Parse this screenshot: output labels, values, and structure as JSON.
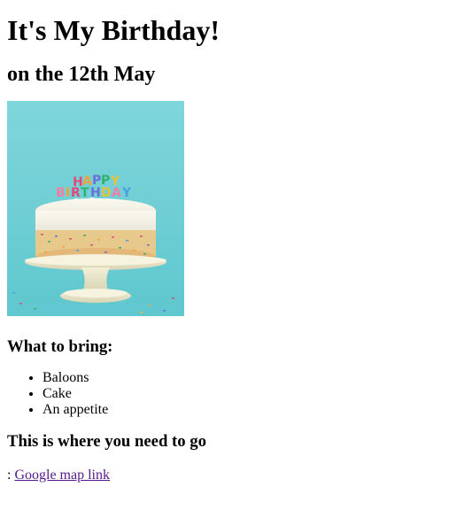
{
  "page": {
    "title": "It's My Birthday!",
    "subtitle": "on the 12th May"
  },
  "image": {
    "alt": "Birthday cake with HAPPY BIRTHDAY candles",
    "candles": [
      "HAPPY",
      "BIRTHDAY"
    ]
  },
  "bring": {
    "heading": "What to bring:",
    "items": [
      "Baloons",
      "Cake",
      "An appetite"
    ]
  },
  "location": {
    "heading": "This is where you need to go",
    "prefix": ":",
    "link_text": "Google map link"
  },
  "colors": {
    "link": "#551a8b",
    "image_bg": "#7fd4d8"
  }
}
